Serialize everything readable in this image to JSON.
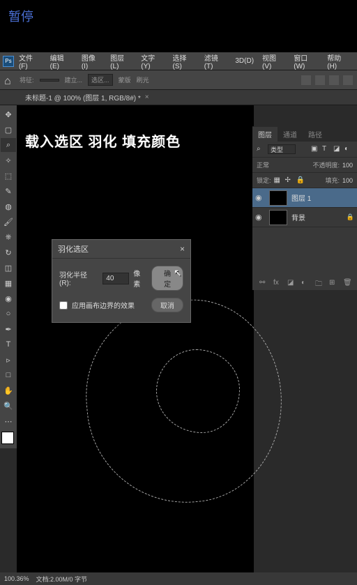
{
  "overlay": {
    "pause": "暂停"
  },
  "menubar": {
    "items": [
      "文件(F)",
      "编辑(E)",
      "图像(I)",
      "图层(L)",
      "文字(Y)",
      "选择(S)",
      "滤镜(T)",
      "3D(D)",
      "视图(V)",
      "窗口(W)",
      "帮助(H)"
    ]
  },
  "optionbar": {
    "presetLabel": "将征:",
    "preset": "",
    "modeLabel": "建立...",
    "mode": "选区...",
    "smoothLabel": "蒙版",
    "antiLabel": "刷光"
  },
  "doc_tab": {
    "title": "未标题-1 @ 100% (图层 1, RGB/8#) *",
    "close": "×"
  },
  "headline": "载入选区 羽化 填充颜色",
  "dialog": {
    "title": "羽化选区",
    "radiusLabel": "羽化半径(R):",
    "radiusValue": "40",
    "unit": "像素",
    "ok": "确定",
    "cancel": "取消",
    "canvasEffect": "应用画布边界的效果"
  },
  "panels": {
    "tabs": [
      "图层",
      "通道",
      "路径"
    ],
    "filterLabel": "类型",
    "opacityLabel": "不透明度:",
    "opacityValue": "100",
    "blendLabel": "正常",
    "lockLabel": "锁定:",
    "fillLabel": "填充:",
    "fillValue": "100",
    "layers": [
      {
        "name": "图层 1",
        "visible": true
      },
      {
        "name": "背景",
        "visible": true,
        "locked": true
      }
    ]
  },
  "statusbar": {
    "zoom": "100.36%",
    "docinfo": "文档:2.00M/0 字节"
  }
}
